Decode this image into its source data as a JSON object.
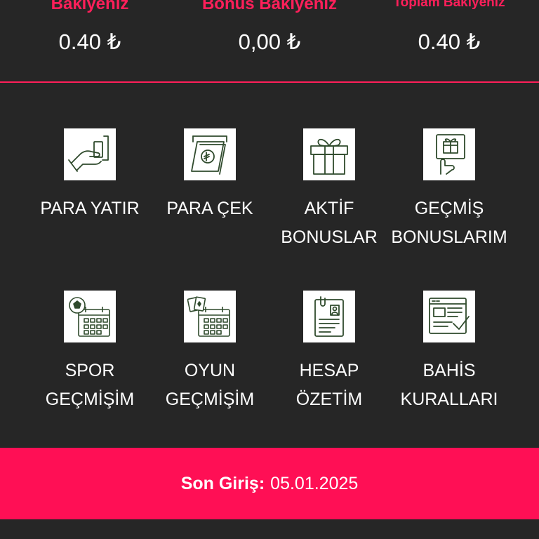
{
  "balances": [
    {
      "label": "Bakiyeniz",
      "value": "0.40 ₺"
    },
    {
      "label": "Bonus Bakiyeniz",
      "value": "0,00 ₺"
    },
    {
      "label": "Toplam Bakiyeniz",
      "value": "0.40 ₺"
    }
  ],
  "menu": [
    {
      "label": "PARA YATIR",
      "icon": "deposit-hand-card-icon"
    },
    {
      "label": "PARA ÇEK",
      "icon": "withdraw-cash-icon"
    },
    {
      "label": "AKTİF\nBONUSLAR",
      "icon": "gift-box-icon"
    },
    {
      "label": "GEÇMİŞ\nBONUSLARIM",
      "icon": "gift-hand-icon"
    },
    {
      "label": "SPOR\nGEÇMİŞİM",
      "icon": "sport-calendar-icon"
    },
    {
      "label": "OYUN\nGEÇMİŞİM",
      "icon": "casino-calendar-icon"
    },
    {
      "label": "HESAP\nÖZETİM",
      "icon": "account-summary-icon"
    },
    {
      "label": "BAHİS\nKURALLARI",
      "icon": "betting-rules-icon"
    }
  ],
  "last_login": {
    "label": "Son Giriş:",
    "value": "05.01.2025"
  },
  "colors": {
    "accent": "#ff0f55",
    "background": "#262626",
    "icon_stroke": "#2f4a2c"
  }
}
